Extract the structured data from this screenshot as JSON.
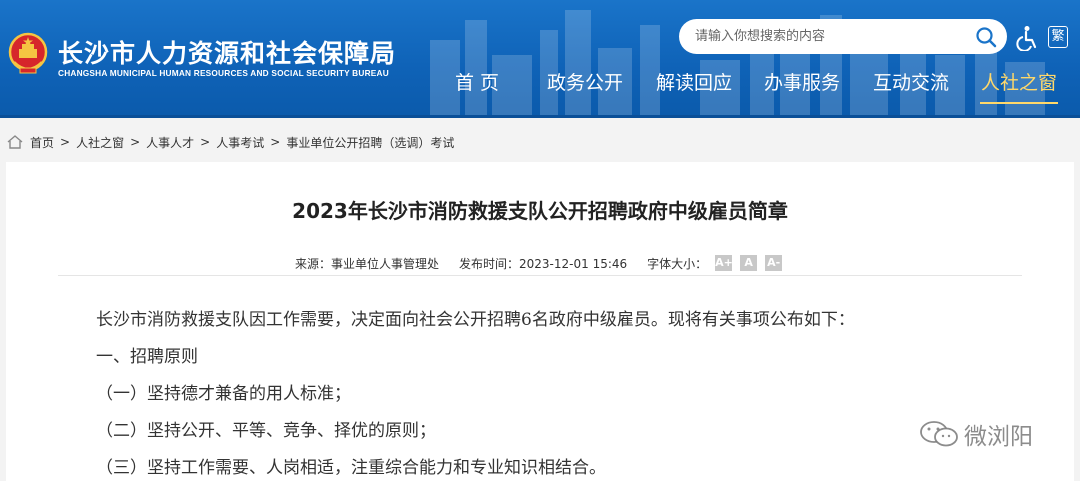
{
  "header": {
    "site_title": "长沙市人力资源和社会保障局",
    "site_subtitle": "CHANGSHA MUNICIPAL HUMAN RESOURCES AND SOCIAL SECURITY BUREAU",
    "search_placeholder": "请输入你想搜索的内容",
    "traditional_label": "繁",
    "colors": {
      "header_blue": "#1a74c9",
      "active_nav": "#ffd86a"
    }
  },
  "nav": {
    "items": [
      {
        "label": "首 页"
      },
      {
        "label": "政务公开"
      },
      {
        "label": "解读回应"
      },
      {
        "label": "办事服务"
      },
      {
        "label": "互动交流"
      },
      {
        "label": "人社之窗",
        "active": true
      }
    ]
  },
  "breadcrumb": {
    "separator": ">",
    "items": [
      "首页",
      "人社之窗",
      "人事人才",
      "人事考试",
      "事业单位公开招聘（选调）考试"
    ]
  },
  "article": {
    "title": "2023年长沙市消防救援支队公开招聘政府中级雇员简章",
    "source_label": "来源：事业单位人事管理处",
    "date_label": "发布时间：2023-12-01 15:46",
    "font_size_label": "字体大小：",
    "font_buttons": [
      "A+",
      "A",
      "A-"
    ],
    "paragraphs": [
      "长沙市消防救援支队因工作需要，决定面向社会公开招聘6名政府中级雇员。现将有关事项公布如下：",
      "一、招聘原则",
      "（一）坚持德才兼备的用人标准；",
      "（二）坚持公开、平等、竞争、择优的原则；",
      "（三）坚持工作需要、人岗相适，注重综合能力和专业知识相结合。"
    ]
  },
  "watermark": {
    "text": "微浏阳"
  }
}
